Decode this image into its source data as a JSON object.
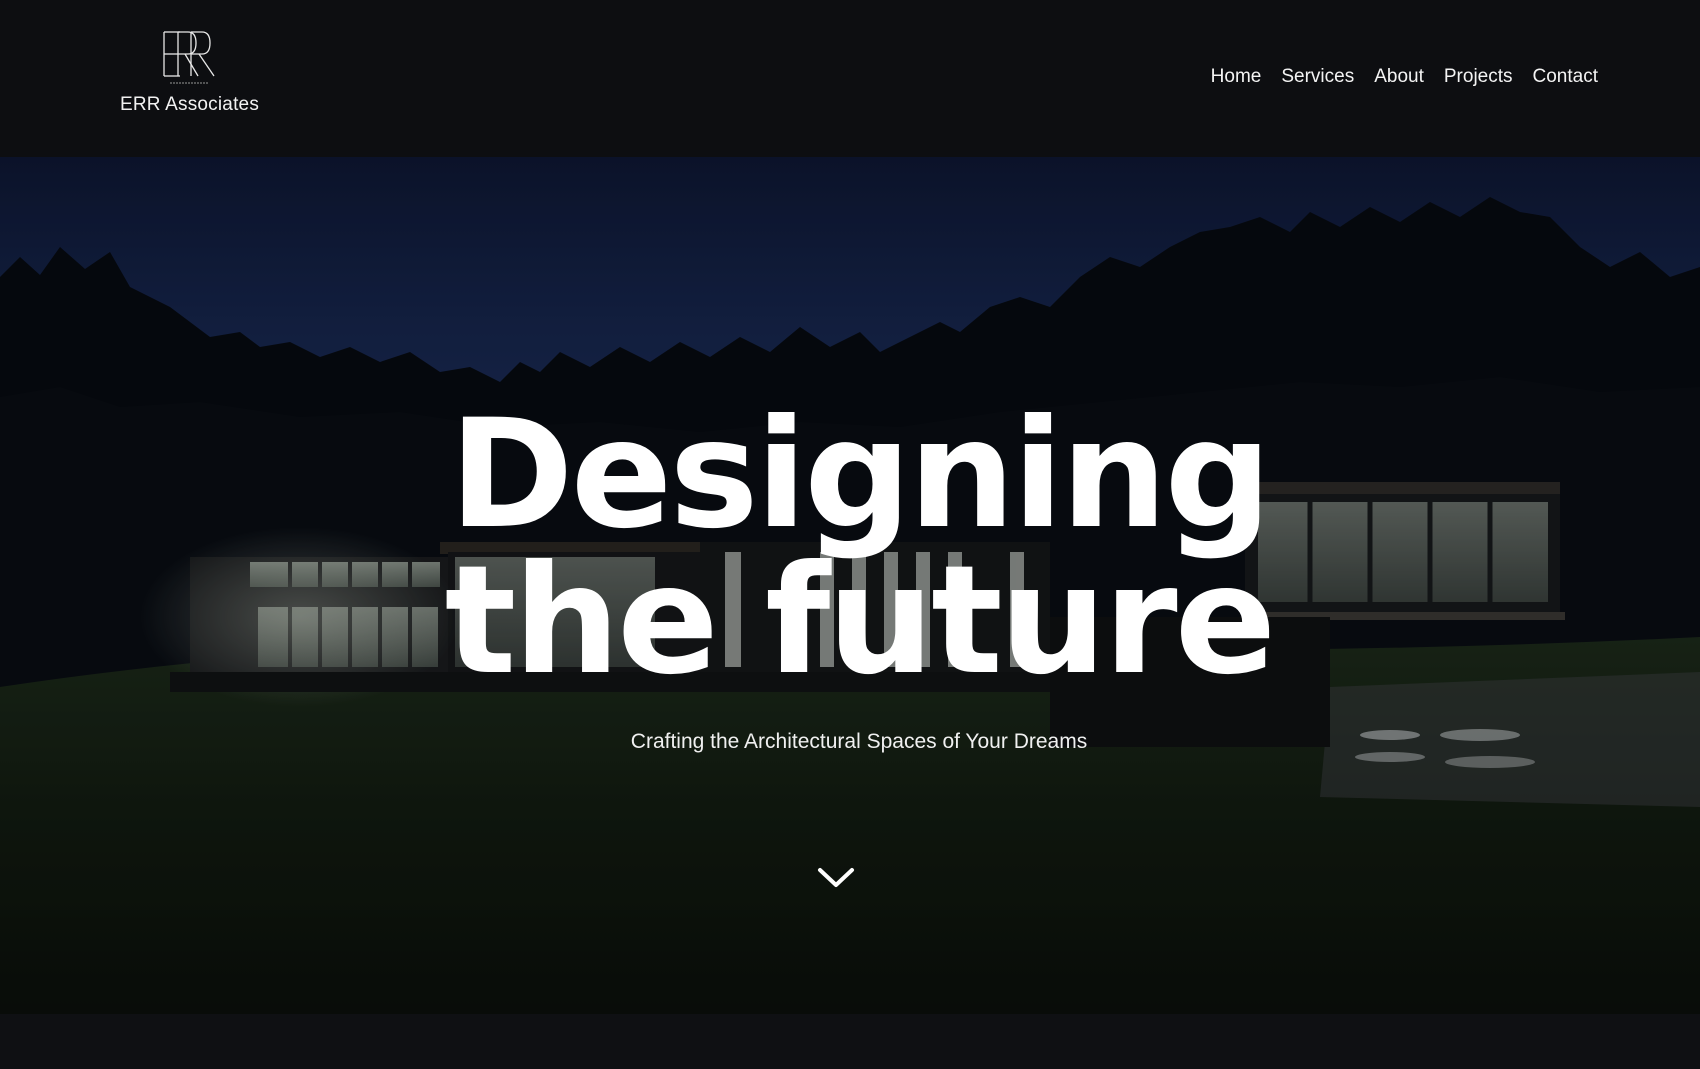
{
  "brand": {
    "name": "ERR Associates",
    "logo_icon": "err-monogram-icon"
  },
  "nav": {
    "items": [
      {
        "label": "Home"
      },
      {
        "label": "Services"
      },
      {
        "label": "About"
      },
      {
        "label": "Projects"
      },
      {
        "label": "Contact"
      }
    ]
  },
  "hero": {
    "title_line1": "Designing",
    "title_line2": "the future",
    "subtitle": "Crafting the Architectural Spaces of Your Dreams",
    "scroll_icon": "chevron-down-icon",
    "background_image": "modern-house-at-night-photo"
  },
  "colors": {
    "header_bg": "#0d0e11",
    "text": "#ffffff",
    "sky_top": "#0e1733",
    "sky_mid": "#1b2b55"
  }
}
